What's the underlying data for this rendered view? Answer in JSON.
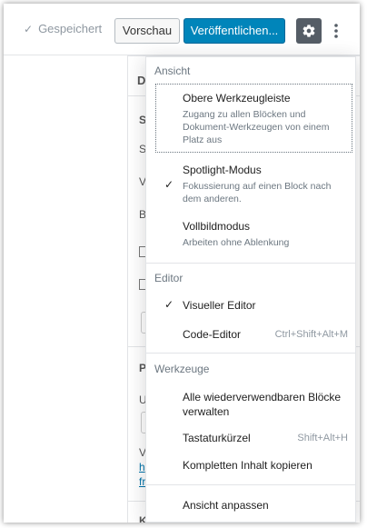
{
  "toolbar": {
    "saved_label": "Gespeichert",
    "preview_label": "Vorschau",
    "publish_label": "Veröffentlichen...",
    "settings_icon": "gear-icon",
    "more_icon": "more-vertical-icon",
    "accent_color": "#0085ba"
  },
  "sidebar": {
    "tab_initial": "D",
    "fragments": [
      "S",
      "S",
      "V",
      "B",
      "P",
      "U",
      "V",
      "h",
      "fr",
      "K"
    ]
  },
  "menu": {
    "view": {
      "title": "Ansicht",
      "items": [
        {
          "label": "Obere Werkzeugleiste",
          "description": "Zugang zu allen Blöcken und Dokument-Werkzeugen von einem Platz aus",
          "checked": false
        },
        {
          "label": "Spotlight-Modus",
          "description": "Fokussierung auf einen Block nach dem anderen.",
          "checked": true
        },
        {
          "label": "Vollbildmodus",
          "description": "Arbeiten ohne Ablenkung",
          "checked": false
        }
      ]
    },
    "editor": {
      "title": "Editor",
      "items": [
        {
          "label": "Visueller Editor",
          "shortcut": "",
          "checked": true
        },
        {
          "label": "Code-Editor",
          "shortcut": "Ctrl+Shift+Alt+M",
          "checked": false
        }
      ]
    },
    "tools": {
      "title": "Werkzeuge",
      "items": [
        {
          "label": "Alle wiederverwendbaren Blöcke verwalten",
          "shortcut": ""
        },
        {
          "label": "Tastaturkürzel",
          "shortcut": "Shift+Alt+H"
        },
        {
          "label": "Kompletten Inhalt kopieren",
          "shortcut": ""
        }
      ]
    },
    "customize_label": "Ansicht anpassen"
  }
}
